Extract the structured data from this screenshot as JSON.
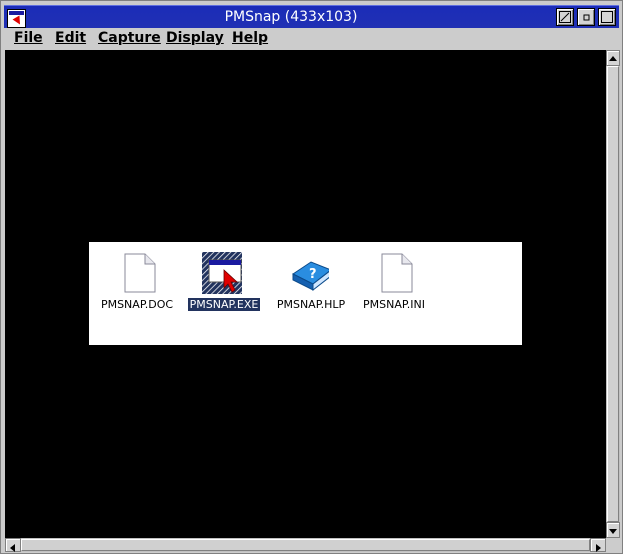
{
  "window": {
    "title": "PMSnap (433x103)"
  },
  "title_buttons": {
    "restore": "restore-icon",
    "minimize": "minimize-icon",
    "maximize": "maximize-icon"
  },
  "menubar": {
    "items": [
      {
        "label": "File"
      },
      {
        "label": "Edit"
      },
      {
        "label": "Capture"
      },
      {
        "label": "Display"
      },
      {
        "label": "Help"
      }
    ]
  },
  "capture": {
    "files": [
      {
        "label": "PMSNAP.DOC",
        "icon": "document-icon",
        "selected": false
      },
      {
        "label": "PMSNAP.EXE",
        "icon": "program-icon",
        "selected": true
      },
      {
        "label": "PMSNAP.HLP",
        "icon": "help-book-icon",
        "selected": false
      },
      {
        "label": "PMSNAP.INI",
        "icon": "document-icon",
        "selected": false
      }
    ]
  },
  "colors": {
    "titlebar": "#1b2cb8",
    "client_bg": "#000000",
    "selection": "#22335e"
  }
}
